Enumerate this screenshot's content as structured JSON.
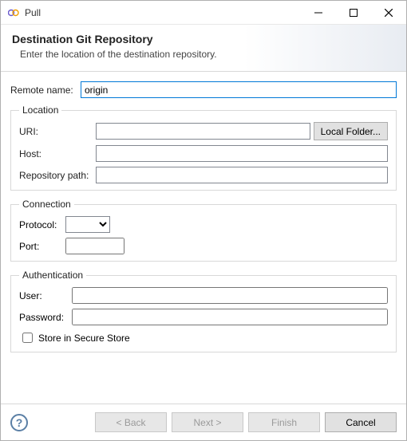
{
  "titlebar": {
    "title": "Pull"
  },
  "header": {
    "title": "Destination Git Repository",
    "description": "Enter the location of the destination repository."
  },
  "form": {
    "remote_name_label": "Remote name:",
    "remote_name_value": "origin",
    "location": {
      "legend": "Location",
      "uri_label": "URI:",
      "uri_value": "",
      "local_folder_btn": "Local Folder...",
      "host_label": "Host:",
      "host_value": "",
      "repo_path_label": "Repository path:",
      "repo_path_value": ""
    },
    "connection": {
      "legend": "Connection",
      "protocol_label": "Protocol:",
      "protocol_value": "",
      "port_label": "Port:",
      "port_value": ""
    },
    "authentication": {
      "legend": "Authentication",
      "user_label": "User:",
      "user_value": "",
      "password_label": "Password:",
      "password_value": "",
      "store_label": "Store in Secure Store",
      "store_checked": false
    }
  },
  "footer": {
    "back": "< Back",
    "next": "Next >",
    "finish": "Finish",
    "cancel": "Cancel"
  }
}
